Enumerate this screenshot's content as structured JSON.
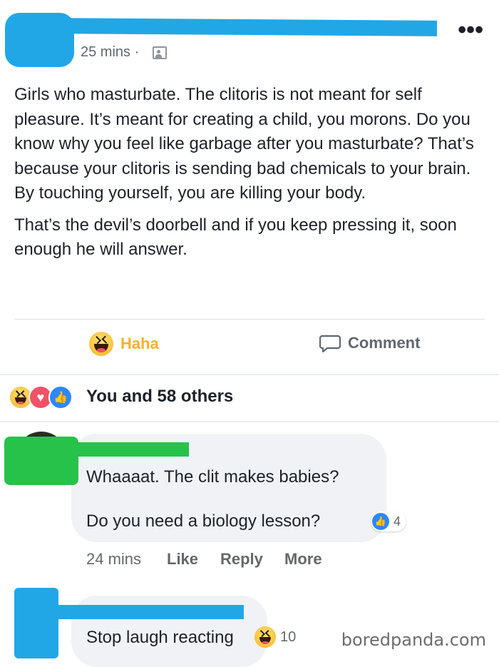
{
  "post": {
    "time": "25 mins ·",
    "more_icon": "more-dots-icon",
    "audience_icon": "friends-icon",
    "paragraphs": [
      "Girls who masturbate. The clitoris is not meant for self pleasure. It’s meant for creating a child, you morons. Do you know why you feel like garbage after you masturbate? That’s because your clitoris is sending bad chemicals to your brain. By touching yourself, you are killing your body.",
      "That’s the devil’s doorbell and if you keep pressing it, soon enough he will answer."
    ]
  },
  "actions": {
    "haha_label": "Haha",
    "comment_label": "Comment"
  },
  "reactions": {
    "summary": "You and 58 others",
    "icons": [
      "haha-icon",
      "love-icon",
      "like-icon"
    ]
  },
  "comments": [
    {
      "lines": [
        "Whaaaat. The clit makes babies?",
        "Do you need a biology lesson?"
      ],
      "like_count": "4",
      "time": "24 mins",
      "actions": [
        "Like",
        "Reply",
        "More"
      ]
    },
    {
      "text": "Stop laugh reacting",
      "haha_count": "10"
    }
  ],
  "watermark": "boredpanda.com",
  "colors": {
    "redact_blue": "#21a7e6",
    "redact_green": "#27c24a",
    "haha_yellow": "#f7b125",
    "like_blue": "#2d88ff",
    "love_red": "#f25268"
  }
}
